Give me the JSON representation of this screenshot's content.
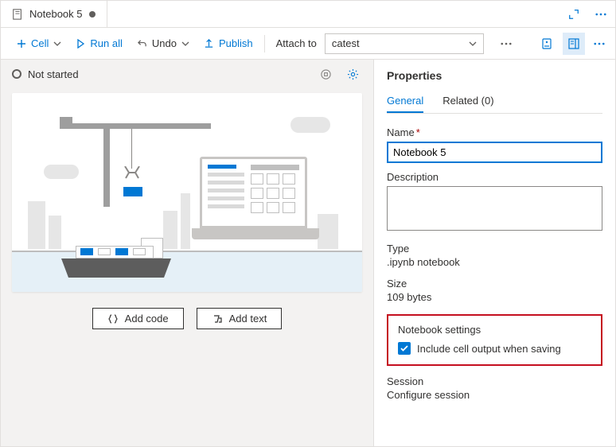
{
  "tab": {
    "title": "Notebook 5"
  },
  "toolbar": {
    "cell": "Cell",
    "runAll": "Run all",
    "undo": "Undo",
    "publish": "Publish",
    "attach": "Attach to",
    "attachValue": "catest"
  },
  "editor": {
    "status": "Not started",
    "addCode": "Add code",
    "addText": "Add text"
  },
  "panel": {
    "title": "Properties",
    "tabs": {
      "general": "General",
      "related": "Related (0)"
    },
    "name": {
      "label": "Name",
      "value": "Notebook 5"
    },
    "description": {
      "label": "Description",
      "value": ""
    },
    "type": {
      "label": "Type",
      "value": ".ipynb notebook"
    },
    "size": {
      "label": "Size",
      "value": "109 bytes"
    },
    "settings": {
      "heading": "Notebook settings",
      "includeOutput": "Include cell output when saving"
    },
    "session": {
      "heading": "Session",
      "configure": "Configure session"
    }
  }
}
